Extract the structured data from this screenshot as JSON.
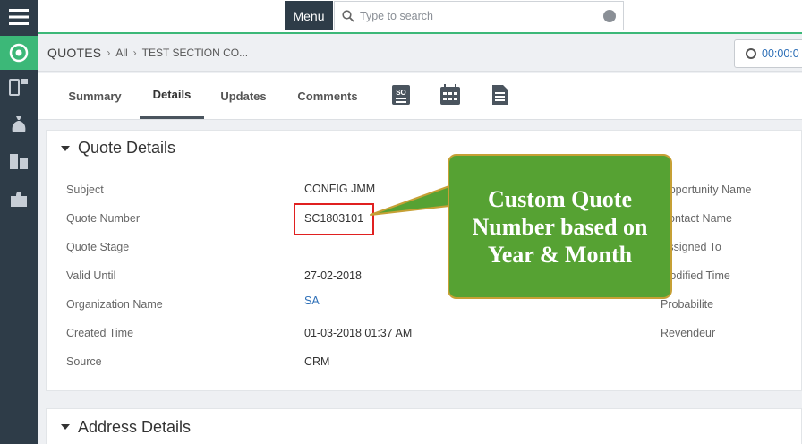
{
  "topbar": {
    "menu_label": "Menu",
    "search_placeholder": "Type to search"
  },
  "breadcrumb": {
    "module": "QUOTES",
    "filter": "All",
    "record": "TEST SECTION CO..."
  },
  "timer": {
    "value": "00:00:0"
  },
  "tabs": [
    {
      "label": "Summary"
    },
    {
      "label": "Details"
    },
    {
      "label": "Updates"
    },
    {
      "label": "Comments"
    }
  ],
  "tab_icons": [
    "so-icon",
    "calendar-icon",
    "document-icon"
  ],
  "quote_details": {
    "title": "Quote Details",
    "left_fields": [
      {
        "label": "Subject",
        "value": "CONFIG JMM"
      },
      {
        "label": "Quote Number",
        "value": "SC1803101"
      },
      {
        "label": "Quote Stage",
        "value": ""
      },
      {
        "label": "Valid Until",
        "value": "27-02-2018"
      },
      {
        "label": "Organization Name",
        "value": "SA"
      },
      {
        "label": "Created Time",
        "value": "01-03-2018 01:37 AM"
      },
      {
        "label": "Source",
        "value": "CRM"
      }
    ],
    "right_fields": [
      {
        "label": "Opportunity Name"
      },
      {
        "label": "Contact Name"
      },
      {
        "label": "Assigned To"
      },
      {
        "label": "Modified Time"
      },
      {
        "label": "Probabilite"
      },
      {
        "label": "Revendeur"
      }
    ]
  },
  "address_details": {
    "title": "Address Details"
  },
  "callout": {
    "line1": "Custom Quote",
    "line2": "Number based on",
    "line3": "Year & Month"
  },
  "colors": {
    "rail": "#2e3c48",
    "accent_green": "#3cb878",
    "callout_green": "#56a233",
    "highlight_red": "#e02020",
    "link_blue": "#2d6fb7"
  }
}
